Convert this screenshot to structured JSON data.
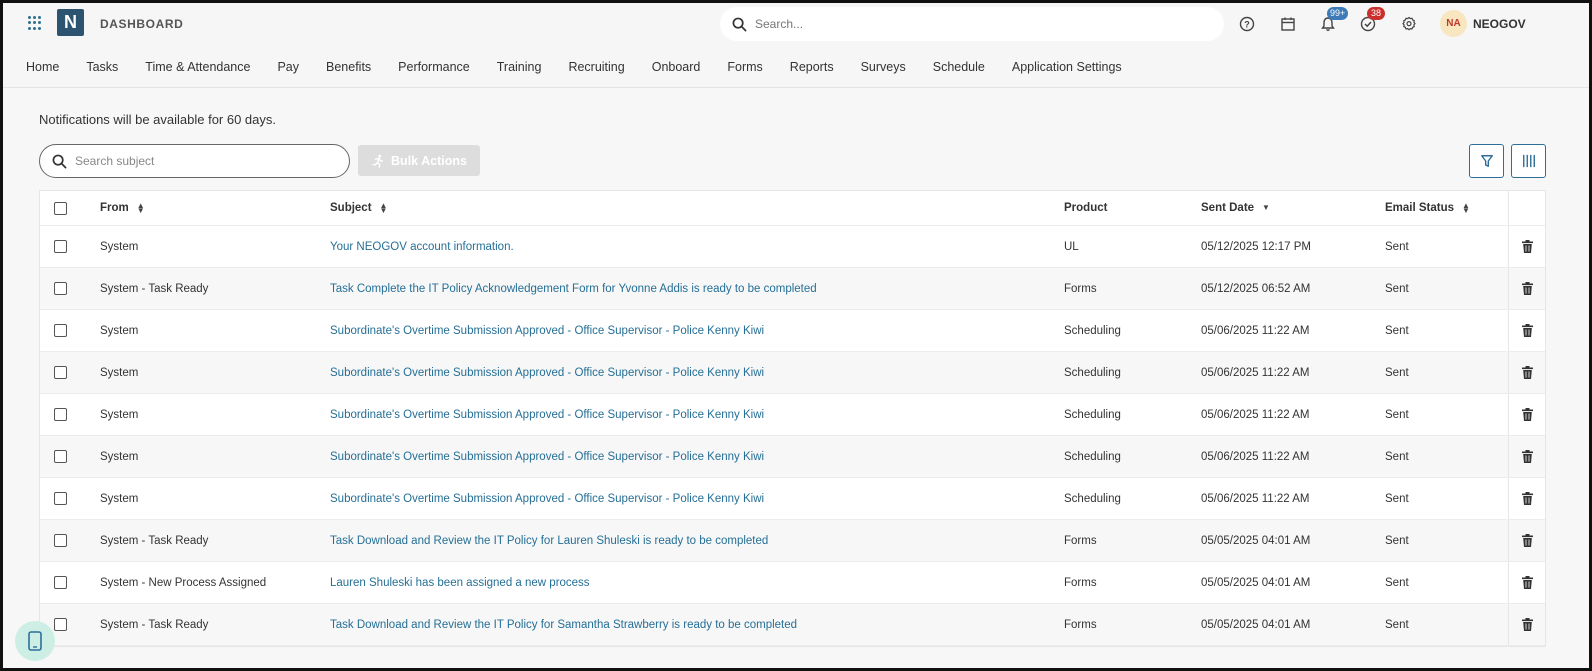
{
  "app": {
    "title": "DASHBOARD",
    "logo_letter": "N",
    "search_placeholder": "Search...",
    "notifications_badge": "99+",
    "tasks_badge": "38",
    "user_initials": "NA",
    "user_name": "NEOGOV",
    "brand_color": "#2c5470",
    "link_color": "#256f96"
  },
  "nav": {
    "items": [
      "Home",
      "Tasks",
      "Time & Attendance",
      "Pay",
      "Benefits",
      "Performance",
      "Training",
      "Recruiting",
      "Onboard",
      "Forms",
      "Reports",
      "Surveys",
      "Schedule",
      "Application Settings"
    ]
  },
  "main": {
    "notice": "Notifications will be available for 60 days.",
    "search_placeholder": "Search subject",
    "bulk_actions_label": "Bulk Actions"
  },
  "table": {
    "columns": {
      "from": "From",
      "subject": "Subject",
      "product": "Product",
      "sent_date": "Sent Date",
      "email_status": "Email Status"
    },
    "rows": [
      {
        "from": "System",
        "subject": "Your NEOGOV account information.",
        "product": "UL",
        "date": "05/12/2025 12:17 PM",
        "status": "Sent"
      },
      {
        "from": "System - Task Ready",
        "subject": "Task Complete the IT Policy Acknowledgement Form for Yvonne Addis is ready to be completed",
        "product": "Forms",
        "date": "05/12/2025 06:52 AM",
        "status": "Sent"
      },
      {
        "from": "System",
        "subject": "Subordinate's Overtime Submission Approved - Office Supervisor - Police Kenny Kiwi",
        "product": "Scheduling",
        "date": "05/06/2025 11:22 AM",
        "status": "Sent"
      },
      {
        "from": "System",
        "subject": "Subordinate's Overtime Submission Approved - Office Supervisor - Police Kenny Kiwi",
        "product": "Scheduling",
        "date": "05/06/2025 11:22 AM",
        "status": "Sent"
      },
      {
        "from": "System",
        "subject": "Subordinate's Overtime Submission Approved - Office Supervisor - Police Kenny Kiwi",
        "product": "Scheduling",
        "date": "05/06/2025 11:22 AM",
        "status": "Sent"
      },
      {
        "from": "System",
        "subject": "Subordinate's Overtime Submission Approved - Office Supervisor - Police Kenny Kiwi",
        "product": "Scheduling",
        "date": "05/06/2025 11:22 AM",
        "status": "Sent"
      },
      {
        "from": "System",
        "subject": "Subordinate's Overtime Submission Approved - Office Supervisor - Police Kenny Kiwi",
        "product": "Scheduling",
        "date": "05/06/2025 11:22 AM",
        "status": "Sent"
      },
      {
        "from": "System - Task Ready",
        "subject": "Task Download and Review the IT Policy for Lauren Shuleski is ready to be completed",
        "product": "Forms",
        "date": "05/05/2025 04:01 AM",
        "status": "Sent"
      },
      {
        "from": "System - New Process Assigned",
        "subject": "Lauren Shuleski has been assigned a new process",
        "product": "Forms",
        "date": "05/05/2025 04:01 AM",
        "status": "Sent"
      },
      {
        "from": "System - Task Ready",
        "subject": "Task Download and Review the IT Policy for Samantha Strawberry is ready to be completed",
        "product": "Forms",
        "date": "05/05/2025 04:01 AM",
        "status": "Sent"
      }
    ]
  }
}
